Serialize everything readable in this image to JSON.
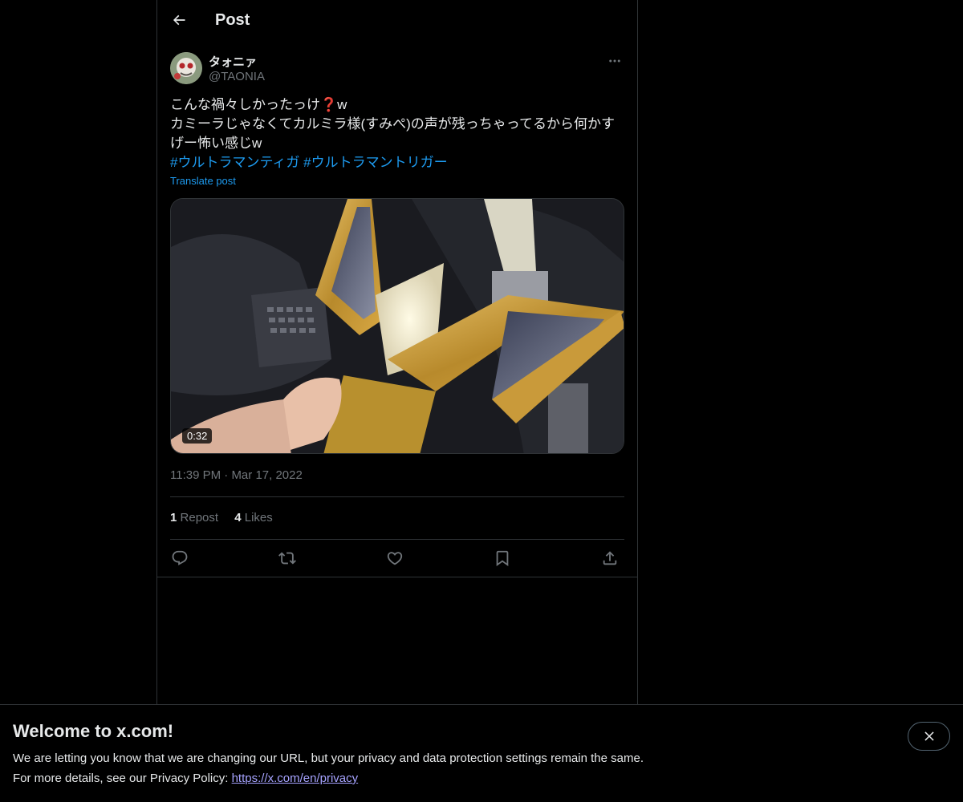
{
  "header": {
    "title": "Post",
    "back_icon": "arrow-left-icon"
  },
  "post": {
    "author": {
      "display_name": "タォニァ",
      "handle": "@TAONIA"
    },
    "text_lines": [
      "こんな禍々しかったっけ❓w",
      "カミーラじゃなくてカルミラ様(すみぺ)の声が残っちゃってるから何かす",
      "げー怖い感じw"
    ],
    "hashtags": [
      "#ウルトラマンティガ",
      "#ウルトラマントリガー"
    ],
    "translate_label": "Translate post",
    "media": {
      "duration": "0:32"
    },
    "time": "11:39 PM",
    "separator": "·",
    "date": "Mar 17, 2022",
    "stats": {
      "reposts_count": "1",
      "reposts_label": "Repost",
      "likes_count": "4",
      "likes_label": "Likes"
    },
    "actions": [
      "reply-icon",
      "repost-icon",
      "like-icon",
      "bookmark-icon",
      "share-icon"
    ]
  },
  "banner": {
    "title": "Welcome to x.com!",
    "line1": "We are letting you know that we are changing our URL, but your privacy and data protection settings remain the same.",
    "line2_prefix": "For more details, see our Privacy Policy: ",
    "link": "https://x.com/en/privacy"
  },
  "colors": {
    "background": "#000000",
    "text": "#e7e9ea",
    "secondary": "#71767b",
    "accent": "#1d9bf0",
    "border": "#2f3336"
  }
}
